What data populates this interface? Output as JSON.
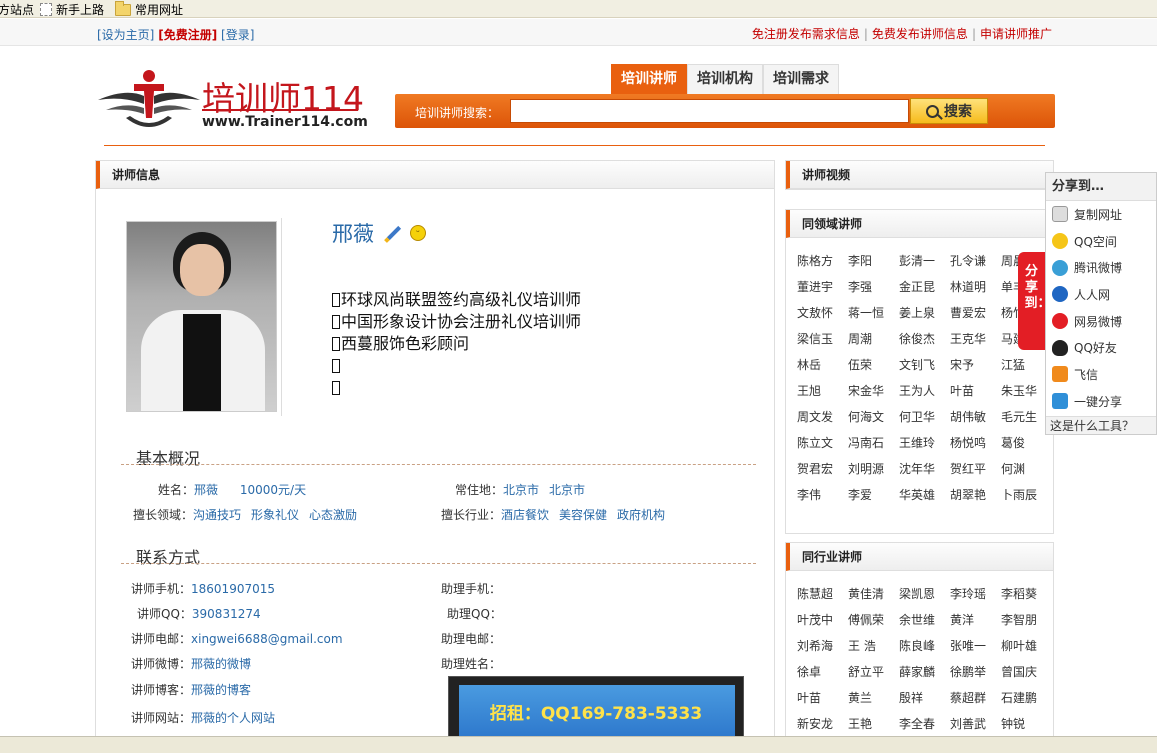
{
  "bookmarks": {
    "items": [
      "方站点",
      "新手上路",
      "常用网址"
    ]
  },
  "topbar": {
    "set_home": "[设为主页]",
    "register": "[免费注册]",
    "login": "[登录]",
    "links": [
      "免注册发布需求信息",
      "免费发布讲师信息",
      "申请讲师推广"
    ],
    "sep": "|"
  },
  "header": {
    "logo_text": "培训师114",
    "logo_url": "www.Trainer114.com",
    "tabs": [
      "培训讲师",
      "培训机构",
      "培训需求"
    ],
    "search_label": "培训讲师搜索：",
    "search_value": "",
    "search_button": "搜索"
  },
  "main": {
    "panel_title": "讲师信息",
    "name": "邢薇",
    "titles": [
      "环球风尚联盟签约高级礼仪培训师",
      "中国形象设计协会注册礼仪培训师",
      "西蔓服饰色彩顾问",
      "",
      ""
    ],
    "basic": {
      "heading": "基本概况",
      "name_label": "姓名：",
      "name_value": "邢薇",
      "fee": "10000元/天",
      "residence_label": "常住地：",
      "residence": [
        "北京市",
        "北京市"
      ],
      "fields_label": "擅长领域：",
      "fields": [
        "沟通技巧",
        "形象礼仪",
        "心态激励"
      ],
      "industry_label": "擅长行业：",
      "industry": [
        "酒店餐饮",
        "美容保健",
        "政府机构"
      ]
    },
    "contact": {
      "heading": "联系方式",
      "phone_label": "讲师手机：",
      "phone": "18601907015",
      "qq_label": "讲师QQ：",
      "qq": "390831274",
      "email_label": "讲师电邮：",
      "email": "xingwei6688@gmail.com",
      "weibo_label": "讲师微博：",
      "weibo": "邢薇的微博",
      "blog_label": "讲师博客：",
      "blog": "邢薇的博客",
      "site_label": "讲师网站：",
      "site": "邢薇的个人网站",
      "asst_phone_label": "助理手机：",
      "asst_qq_label": "助理QQ：",
      "asst_email_label": "助理电邮：",
      "asst_name_label": "助理姓名："
    },
    "ad_text": "招租：QQ169-783-5333"
  },
  "sidebar": {
    "video_title": "讲师视频",
    "same_field_title": "同领域讲师",
    "same_field": [
      "陈格方",
      "李阳",
      "彭清一",
      "孔令谦",
      "周晨",
      "董进宇",
      "李强",
      "金正昆",
      "林道明",
      "单丰",
      "文敖怀",
      "蒋一恒",
      "姜上泉",
      "曹爱宏",
      "杨竹",
      "梁信玉",
      "周潮",
      "徐俊杰",
      "王克华",
      "马建",
      "林岳",
      "伍荣",
      "文钊飞",
      "宋予",
      "江猛",
      "王旭",
      "宋金华",
      "王为人",
      "叶苗",
      "朱玉华",
      "周文发",
      "何海文",
      "何卫华",
      "胡伟敏",
      "毛元生",
      "陈立文",
      "冯南石",
      "王维玲",
      "杨悦鸣",
      "葛俊",
      "贺君宏",
      "刘明源",
      "沈年华",
      "贺红平",
      "何渊",
      "李伟",
      "李爱",
      "华英雄",
      "胡翠艳",
      "卜雨辰"
    ],
    "same_industry_title": "同行业讲师",
    "same_industry": [
      "陈慧超",
      "黄佳清",
      "梁凯恩",
      "李玲瑶",
      "李稻葵",
      "叶茂中",
      "傅佩荣",
      "余世维",
      "黄洋",
      "李智朋",
      "刘希海",
      "王 浩",
      "陈良峰",
      "张唯一",
      "柳叶雄",
      "徐卓",
      "舒立平",
      "薛家麟",
      "徐鹏举",
      "曾国庆",
      "叶苗",
      "黄兰",
      "殷祥",
      "蔡超群",
      "石建鹏",
      "新安龙",
      "王艳",
      "李全春",
      "刘善武",
      "钟锐"
    ]
  },
  "share": {
    "tab_label": "分享到：",
    "title": "分享到…",
    "items": [
      "复制网址",
      "QQ空间",
      "腾讯微博",
      "人人网",
      "网易微博",
      "QQ好友",
      "飞信",
      "一键分享"
    ],
    "footer": "这是什么工具？"
  }
}
